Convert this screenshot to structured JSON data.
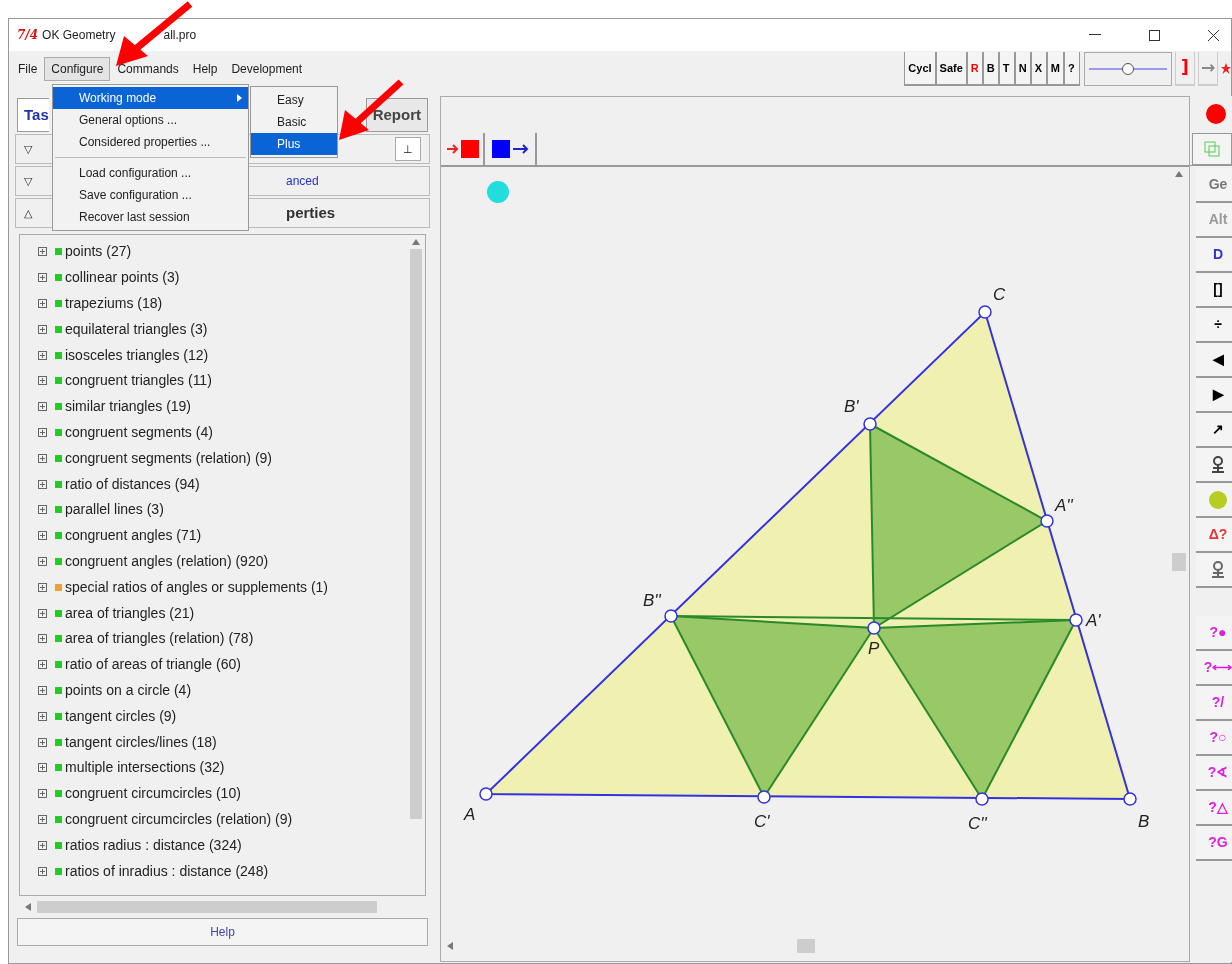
{
  "window": {
    "logo": "7/4",
    "title_parts": [
      "OK Geometry",
      "all.pro"
    ]
  },
  "menu_bar": [
    {
      "label": "File",
      "selected": false
    },
    {
      "label": "Configure",
      "selected": true
    },
    {
      "label": "Commands",
      "selected": false
    },
    {
      "label": "Help",
      "selected": false
    },
    {
      "label": "Development",
      "selected": false
    }
  ],
  "open_menu": [
    {
      "kind": "item",
      "label": "Working mode",
      "highlighted": true,
      "submenu": true
    },
    {
      "kind": "item",
      "label": "General options ...",
      "highlighted": false,
      "submenu": false
    },
    {
      "kind": "item",
      "label": "Considered properties ...",
      "highlighted": false,
      "submenu": false
    },
    {
      "kind": "separator"
    },
    {
      "kind": "item",
      "label": "Load configuration ...",
      "highlighted": false,
      "submenu": false
    },
    {
      "kind": "item",
      "label": "Save configuration ...",
      "highlighted": false,
      "submenu": false
    },
    {
      "kind": "item",
      "label": "Recover last session",
      "highlighted": false,
      "submenu": false
    }
  ],
  "submenu": [
    {
      "label": "Easy",
      "selected": false
    },
    {
      "label": "Basic",
      "selected": false
    },
    {
      "label": "Plus",
      "selected": true
    }
  ],
  "toolbar": [
    {
      "label": "Cycl",
      "color": "#000000"
    },
    {
      "label": "Safe",
      "color": "#000000"
    },
    {
      "label": "R",
      "color": "#ff0000"
    },
    {
      "label": "B",
      "color": "#000000"
    },
    {
      "label": "T",
      "color": "#000000"
    },
    {
      "label": "N",
      "color": "#000000"
    },
    {
      "label": "X",
      "color": "#000000"
    },
    {
      "label": "M",
      "color": "#000000"
    },
    {
      "label": "?",
      "color": "#000000"
    }
  ],
  "toolbar_slider": {
    "level": 0.5
  },
  "toolbar_extra": [
    {
      "label": "]",
      "color": "#ff0000"
    },
    {
      "label": "→",
      "color": "#888888"
    }
  ],
  "left_panel": {
    "tabs": [
      {
        "label": "Tas",
        "selected": true
      },
      {
        "label": "Report",
        "selected": false
      }
    ],
    "sections": [
      {
        "kind": "button",
        "toggle": "▽",
        "button": "⊥"
      },
      {
        "kind": "link",
        "toggle": "▽",
        "text": "anced"
      },
      {
        "kind": "title",
        "toggle": "△",
        "text": "perties"
      }
    ],
    "tree": [
      {
        "label": "points (27)",
        "color": "#22cc22"
      },
      {
        "label": "collinear points (3)",
        "color": "#22cc22"
      },
      {
        "label": "trapeziums (18)",
        "color": "#22cc22"
      },
      {
        "label": "equilateral triangles (3)",
        "color": "#22cc22"
      },
      {
        "label": "isosceles triangles (12)",
        "color": "#22cc22"
      },
      {
        "label": "congruent triangles (11)",
        "color": "#22cc22"
      },
      {
        "label": "similar triangles (19)",
        "color": "#22cc22"
      },
      {
        "label": "congruent segments (4)",
        "color": "#22cc22"
      },
      {
        "label": "congruent segments (relation) (9)",
        "color": "#22cc22"
      },
      {
        "label": "ratio of distances (94)",
        "color": "#22cc22"
      },
      {
        "label": "parallel lines (3)",
        "color": "#22cc22"
      },
      {
        "label": "congruent angles (71)",
        "color": "#22cc22"
      },
      {
        "label": "congruent angles (relation) (920)",
        "color": "#22cc22"
      },
      {
        "label": "special ratios of angles or supplements (1)",
        "color": "#f0a030"
      },
      {
        "label": "area of triangles (21)",
        "color": "#22cc22"
      },
      {
        "label": "area of triangles (relation) (78)",
        "color": "#22cc22"
      },
      {
        "label": "ratio of areas of triangle (60)",
        "color": "#22cc22"
      },
      {
        "label": "points on a circle (4)",
        "color": "#22cc22"
      },
      {
        "label": "tangent circles (9)",
        "color": "#22cc22"
      },
      {
        "label": "tangent circles/lines (18)",
        "color": "#22cc22"
      },
      {
        "label": "multiple intersections (32)",
        "color": "#22cc22"
      },
      {
        "label": "congruent circumcircles (10)",
        "color": "#22cc22"
      },
      {
        "label": "congruent circumcircles (relation) (9)",
        "color": "#22cc22"
      },
      {
        "label": "ratios radius : distance (324)",
        "color": "#22cc22"
      },
      {
        "label": "ratios of inradius : distance (248)",
        "color": "#22cc22"
      }
    ],
    "help_button": "Help"
  },
  "canvas": {
    "points": [
      {
        "label": "A"
      },
      {
        "label": "B"
      },
      {
        "label": "C"
      },
      {
        "label": "B'"
      },
      {
        "label": "A''"
      },
      {
        "label": "B''"
      },
      {
        "label": "P"
      },
      {
        "label": "A'"
      },
      {
        "label": "C'"
      },
      {
        "label": "C''"
      }
    ]
  },
  "right_bar": [
    {
      "kind": "text",
      "label": "Ge",
      "color": "#777777"
    },
    {
      "kind": "text",
      "label": "Alt",
      "color": "#999999"
    },
    {
      "kind": "text",
      "label": "D",
      "color": "#3333cc"
    },
    {
      "kind": "text",
      "label": "[]",
      "color": "#000000"
    },
    {
      "kind": "text",
      "label": "÷",
      "color": "#000000"
    },
    {
      "kind": "text",
      "label": "◀",
      "color": "#000000"
    },
    {
      "kind": "text",
      "label": "▶",
      "color": "#000000"
    },
    {
      "kind": "text",
      "label": "↗",
      "color": "#000000"
    },
    {
      "kind": "figure",
      "color": "#444444"
    },
    {
      "kind": "dot",
      "color": "#b8cc22"
    },
    {
      "kind": "text",
      "label": "Δ?",
      "color": "#ee3333"
    },
    {
      "kind": "figure",
      "color": "#666666"
    },
    {
      "kind": "gap"
    },
    {
      "kind": "text",
      "label": "?●",
      "color": "#dd22dd"
    },
    {
      "kind": "text",
      "label": "?⟷",
      "color": "#dd22dd"
    },
    {
      "kind": "text",
      "label": "?/",
      "color": "#dd22dd"
    },
    {
      "kind": "text",
      "label": "?○",
      "color": "#dd22dd"
    },
    {
      "kind": "text",
      "label": "?∢",
      "color": "#dd22dd"
    },
    {
      "kind": "text",
      "label": "?△",
      "color": "#dd22dd"
    },
    {
      "kind": "text",
      "label": "?G",
      "color": "#dd22dd"
    }
  ]
}
